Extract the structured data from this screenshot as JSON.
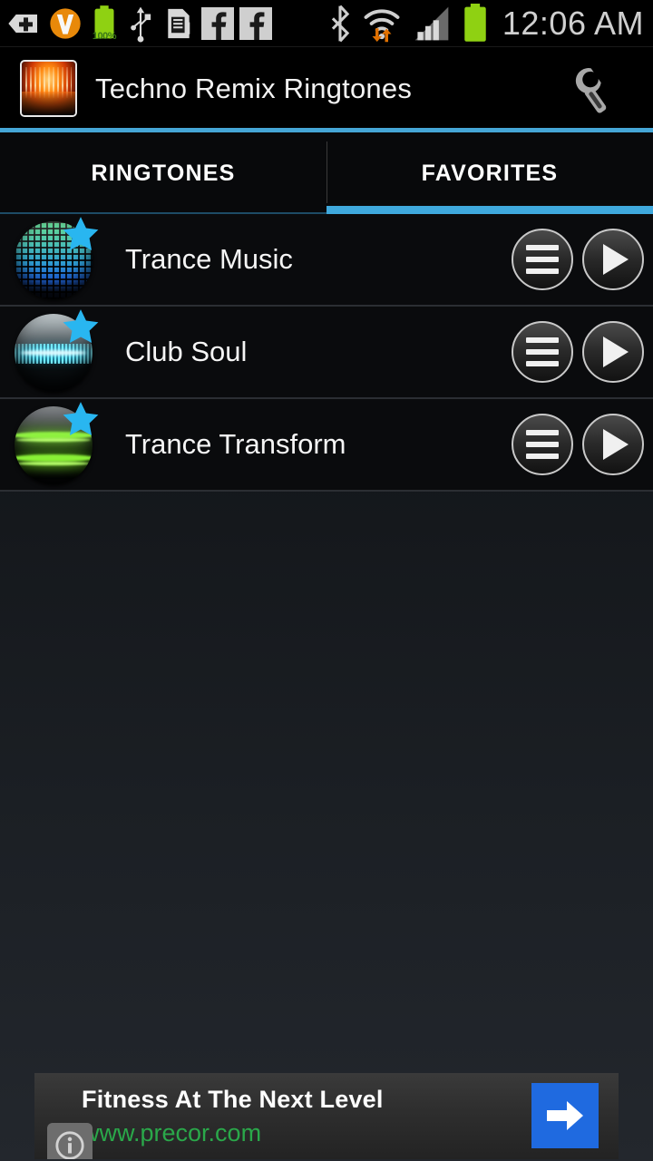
{
  "statusbar": {
    "left_icons": [
      {
        "name": "back-plus-icon"
      },
      {
        "name": "viber-icon"
      },
      {
        "name": "battery-charge-icon",
        "label": "100%"
      },
      {
        "name": "usb-icon"
      },
      {
        "name": "sd-card-icon"
      },
      {
        "name": "facebook-icon"
      },
      {
        "name": "facebook-icon-2"
      }
    ],
    "right_icons": [
      {
        "name": "bluetooth-icon"
      },
      {
        "name": "wifi-icon"
      },
      {
        "name": "cellular-signal-icon"
      },
      {
        "name": "battery-icon"
      }
    ],
    "clock": "12:06 AM",
    "battery_percent": "100%"
  },
  "titlebar": {
    "app_icon_name": "app-logo-equalizer",
    "title": "Techno Remix Ringtones",
    "settings_icon_name": "wrench-icon"
  },
  "tabs": [
    {
      "label": "RINGTONES",
      "active": false
    },
    {
      "label": "FAVORITES",
      "active": true
    }
  ],
  "list": [
    {
      "title": "Trance Music",
      "thumb_style": "eq",
      "favorite": true,
      "menu_icon": "menu-icon",
      "play_icon": "play-icon"
    },
    {
      "title": "Club Soul",
      "thumb_style": "wave",
      "favorite": true,
      "menu_icon": "menu-icon",
      "play_icon": "play-icon"
    },
    {
      "title": "Trance Transform",
      "thumb_style": "bands",
      "favorite": true,
      "menu_icon": "menu-icon",
      "play_icon": "play-icon"
    }
  ],
  "ad": {
    "headline": "Fitness At The Next Level",
    "url": "www.precor.com",
    "cta_icon": "arrow-right-icon",
    "info_icon": "info-icon"
  },
  "colors": {
    "accent_blue": "#3fa9dd",
    "rule_blue": "#45a6d6",
    "star_cyan": "#29b6f0",
    "ad_url_green": "#2aa84a",
    "ad_cta_blue": "#1f6ae0",
    "battery_green": "#8fd112"
  }
}
